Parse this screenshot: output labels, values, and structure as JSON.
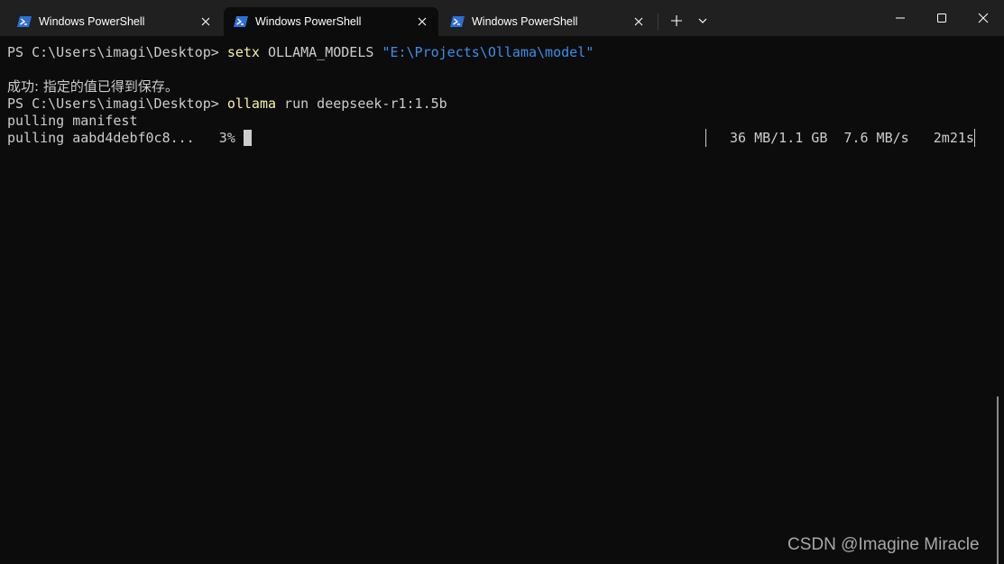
{
  "tabs": [
    {
      "label": "Windows PowerShell",
      "active": false
    },
    {
      "label": "Windows PowerShell",
      "active": true
    },
    {
      "label": "Windows PowerShell",
      "active": false
    }
  ],
  "icons": {
    "tab_icon": "powershell-icon",
    "tab_close": "close-icon",
    "new_tab": "plus-icon",
    "dropdown": "chevron-down-icon",
    "minimize": "minimize-icon",
    "maximize": "maximize-icon",
    "close": "close-icon"
  },
  "terminal": {
    "line1": {
      "prompt": "PS C:\\Users\\imagi\\Desktop> ",
      "command": "setx",
      "args": " OLLAMA_MODELS ",
      "string": "\"E:\\Projects\\Ollama\\model\""
    },
    "line2": "成功: 指定的值已得到保存。",
    "line3": {
      "prompt": "PS C:\\Users\\imagi\\Desktop> ",
      "command": "ollama",
      "args": " run deepseek-r1:1.5b"
    },
    "line4": "pulling manifest",
    "line5": {
      "text": "pulling aabd4debf0c8...   3% ",
      "progress": 0.03,
      "stats": "36 MB/1.1 GB  7.6 MB/s   2m21s"
    }
  },
  "watermark": "CSDN @Imagine Miracle",
  "colors": {
    "background": "#0c0c0c",
    "titlebar": "#202020",
    "text": "#cccccc",
    "command": "#f9f1a5",
    "string": "#3b8eea",
    "icon_blue": "#2f6fd6"
  }
}
